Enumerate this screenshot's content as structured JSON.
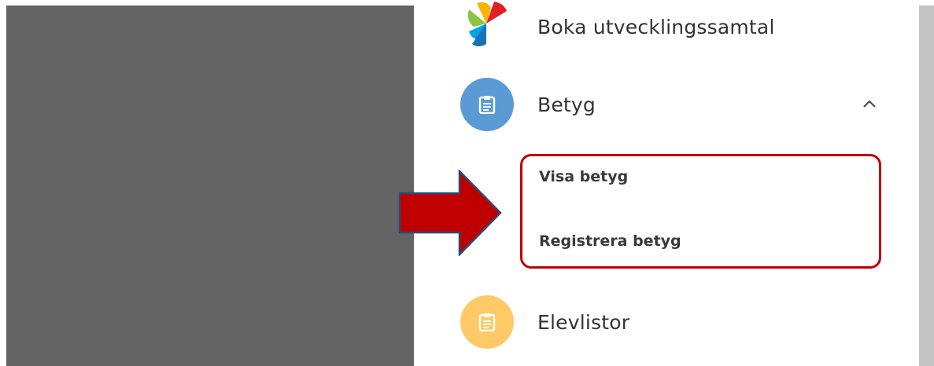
{
  "menu": {
    "items": [
      {
        "label": "Boka utvecklingssamtal",
        "icon": "pinwheel-logo-icon"
      },
      {
        "label": "Betyg",
        "icon": "clipboard-icon",
        "color": "#5b9bd5",
        "expanded": true
      },
      {
        "label": "Elevlistor",
        "icon": "clipboard-icon",
        "color": "#ffc966"
      }
    ],
    "submenu": [
      {
        "label": "Visa betyg"
      },
      {
        "label": "Registrera betyg"
      }
    ]
  },
  "annotation": {
    "arrow_color": "#c00000",
    "box_color": "#c00000"
  },
  "colors": {
    "overlay": "#646464",
    "scrollbar": "#c4c4c4"
  }
}
